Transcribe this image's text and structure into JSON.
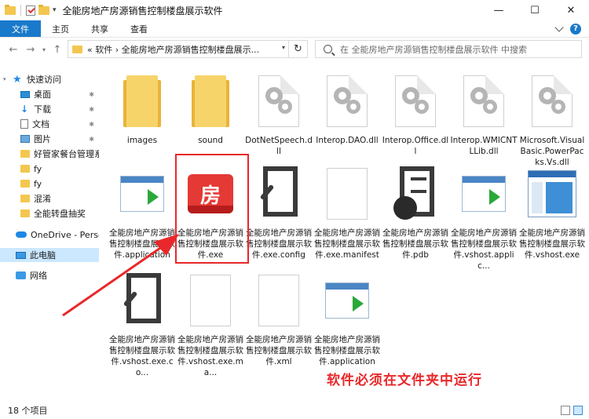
{
  "window": {
    "title": "全能房地产房源销售控制楼盘展示软件",
    "minimize": "—",
    "maximize": "☐",
    "close": "✕"
  },
  "ribbon": {
    "tabs": [
      "文件",
      "主页",
      "共享",
      "查看"
    ]
  },
  "address": {
    "path": "«  软件  ›  全能房地产房源销售控制楼盘展示...",
    "search_placeholder": "在 全能房地产房源销售控制楼盘展示软件 中搜索"
  },
  "nav": {
    "items": [
      {
        "label": "快速访问"
      },
      {
        "label": "桌面"
      },
      {
        "label": "下载"
      },
      {
        "label": "文档"
      },
      {
        "label": "图片"
      },
      {
        "label": "好管家餐台管理系"
      },
      {
        "label": "fy"
      },
      {
        "label": "fy"
      },
      {
        "label": "混淆"
      },
      {
        "label": "全能转盘抽奖"
      },
      {
        "label": "OneDrive - Persona"
      },
      {
        "label": "此电脑"
      },
      {
        "label": "网络"
      }
    ]
  },
  "files": [
    {
      "name": "images",
      "icon": "folder-icon"
    },
    {
      "name": "sound",
      "icon": "folder-icon"
    },
    {
      "name": "DotNetSpeech.dll",
      "icon": "dll-icon"
    },
    {
      "name": "Interop.DAO.dll",
      "icon": "dll-icon"
    },
    {
      "name": "Interop.Office.dll",
      "icon": "dll-icon"
    },
    {
      "name": "Interop.WMICNTLLib.dll",
      "icon": "dll-icon"
    },
    {
      "name": "Microsoft.VisualBasic.PowerPacks.Vs.dll",
      "icon": "dll-icon"
    },
    {
      "name": "全能房地产房源销售控制楼盘展示软件.application",
      "icon": "application-icon"
    },
    {
      "name": "全能房地产房源销售控制楼盘展示软件.exe",
      "icon": "exe-icon"
    },
    {
      "name": "全能房地产房源销售控制楼盘展示软件.exe.config",
      "icon": "config-icon"
    },
    {
      "name": "全能房地产房源销售控制楼盘展示软件.exe.manifest",
      "icon": "blank-file-icon"
    },
    {
      "name": "全能房地产房源销售控制楼盘展示软件.pdb",
      "icon": "pdb-icon"
    },
    {
      "name": "全能房地产房源销售控制楼盘展示软件.vshost.applic...",
      "icon": "application-icon"
    },
    {
      "name": "全能房地产房源销售控制楼盘展示软件.vshost.exe",
      "icon": "vshost-icon"
    },
    {
      "name": "全能房地产房源销售控制楼盘展示软件.vshost.exe.co...",
      "icon": "config-icon"
    },
    {
      "name": "全能房地产房源销售控制楼盘展示软件.vshost.exe.ma...",
      "icon": "blank-file-icon"
    },
    {
      "name": "全能房地产房源销售控制楼盘展示软件.xml",
      "icon": "blank-file-icon"
    },
    {
      "name": "全能房地产房源销售控制楼盘展示软件.application",
      "icon": "application-icon"
    }
  ],
  "exe_logo_char": "房",
  "status": {
    "count": "18 个项目"
  },
  "annotation": "软件必须在文件夹中运行",
  "colors": {
    "accent": "#1979ca",
    "highlight": "#e8282a"
  }
}
